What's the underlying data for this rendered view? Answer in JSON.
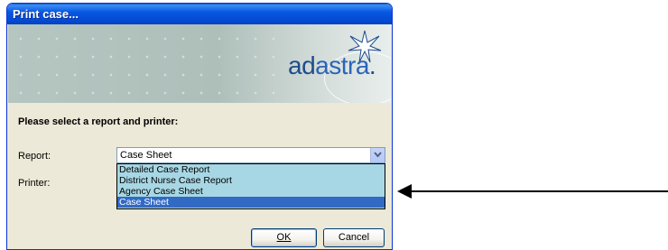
{
  "window": {
    "title": "Print case..."
  },
  "banner": {
    "brand_prefix": "ad",
    "brand_suffix": "astra",
    "brand_mark": "."
  },
  "form": {
    "instruction": "Please select a report and printer:",
    "report_label": "Report:",
    "printer_label": "Printer:",
    "report_value": "Case Sheet",
    "report_options": [
      "Detailed Case Report",
      "District Nurse Case Report",
      "Agency Case Sheet",
      "Case Sheet"
    ],
    "selected_index": 3
  },
  "buttons": {
    "ok": "OK",
    "cancel": "Cancel"
  },
  "icons": {
    "combo_arrow": "chevron-down-icon",
    "pointer": "arrow-left-icon",
    "logo": "star-icon"
  },
  "colors": {
    "title_bar": "#0858e2",
    "dialog_bg": "#ece9d8",
    "dropdown_bg": "#a7d7e4",
    "selection": "#316ac5"
  }
}
